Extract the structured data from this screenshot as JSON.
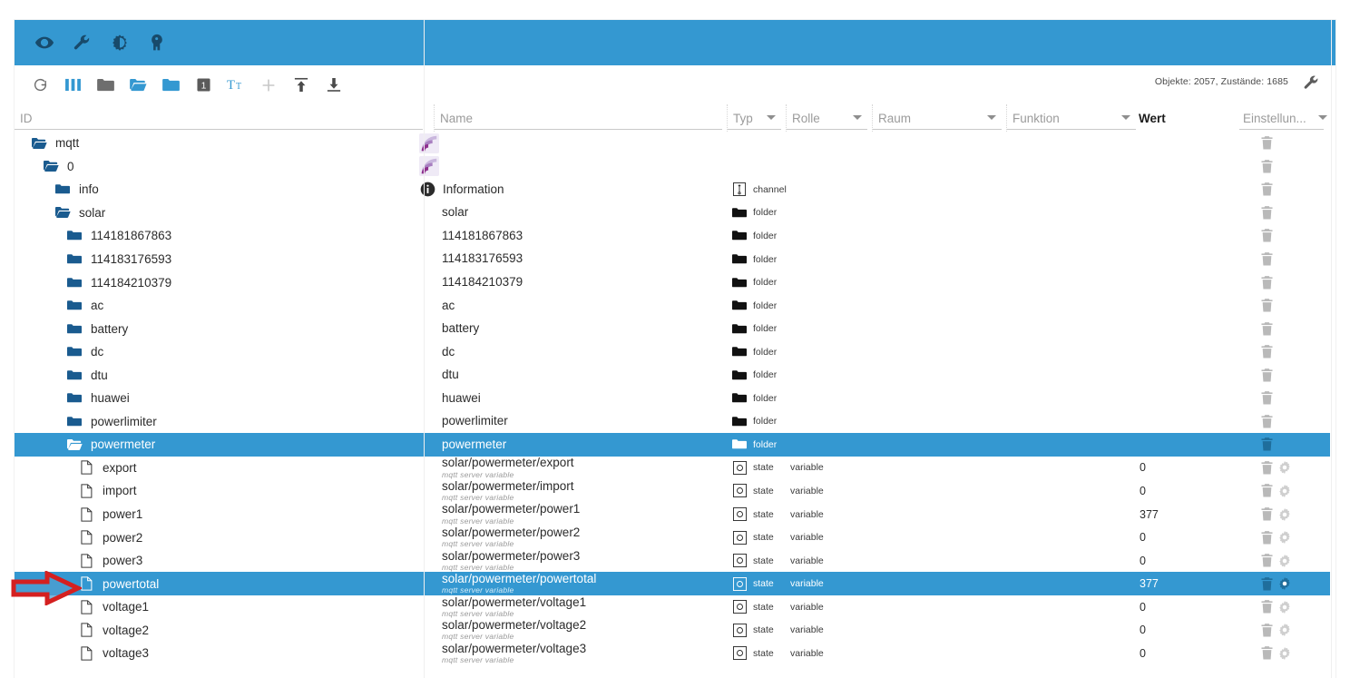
{
  "window": {
    "topbar_icons": [
      {
        "name": "eye-icon",
        "label": "eye"
      },
      {
        "name": "wrench-icon",
        "label": "wrench"
      },
      {
        "name": "contrast-icon",
        "label": "contrast"
      },
      {
        "name": "user-head-icon",
        "label": "user"
      }
    ]
  },
  "toolbar": {
    "icons": [
      {
        "name": "refresh-icon",
        "label": "Refresh"
      },
      {
        "name": "columns-icon",
        "label": "Columns"
      },
      {
        "name": "folder-closed-icon",
        "label": "Collapse all"
      },
      {
        "name": "folder-open-icon",
        "label": "Expand all"
      },
      {
        "name": "folder-filled-icon",
        "label": "Folders"
      },
      {
        "name": "depth-one-icon",
        "label": "1"
      },
      {
        "name": "text-size-icon",
        "label": "Tt"
      },
      {
        "name": "add-icon",
        "label": "Add"
      },
      {
        "name": "import-icon",
        "label": "Import"
      },
      {
        "name": "export-icon",
        "label": "Export"
      }
    ],
    "counts": "Objekte: 2057, Zustände: 1685",
    "settings_icon": "wrench-icon"
  },
  "columns": {
    "id": "ID",
    "name": "Name",
    "typ": "Typ",
    "rolle": "Rolle",
    "raum": "Raum",
    "funktion": "Funktion",
    "wert": "Wert",
    "einstellungen": "Einstellun..."
  },
  "rows": [
    {
      "id": "mqtt",
      "depth": 0,
      "icon": "folder-open-icon",
      "adapter_icon": "mqtt-adapter-icon",
      "name": "",
      "sub": "",
      "type": "",
      "role": "",
      "value": "",
      "actions": [
        "delete-icon"
      ],
      "selected": false
    },
    {
      "id": "0",
      "depth": 1,
      "icon": "folder-open-icon",
      "adapter_icon": "mqtt-adapter-icon",
      "name": "",
      "sub": "",
      "type": "",
      "role": "",
      "value": "",
      "actions": [
        "delete-icon"
      ],
      "selected": false
    },
    {
      "id": "info",
      "depth": 2,
      "icon": "folder-closed-icon",
      "adapter_icon": "",
      "name": "Information",
      "name_icon": "information-icon",
      "sub": "",
      "type": "channel",
      "type_icon": "channel-icon",
      "role": "",
      "value": "",
      "actions": [
        "delete-icon"
      ],
      "selected": false
    },
    {
      "id": "solar",
      "depth": 2,
      "icon": "folder-open-icon",
      "adapter_icon": "",
      "name": "solar",
      "sub": "",
      "type": "folder",
      "type_icon": "folder-icon",
      "role": "",
      "value": "",
      "actions": [
        "delete-icon"
      ],
      "selected": false
    },
    {
      "id": "114181867863",
      "depth": 3,
      "icon": "folder-closed-icon",
      "adapter_icon": "",
      "name": "114181867863",
      "sub": "",
      "type": "folder",
      "type_icon": "folder-icon",
      "role": "",
      "value": "",
      "actions": [
        "delete-icon"
      ],
      "selected": false
    },
    {
      "id": "114183176593",
      "depth": 3,
      "icon": "folder-closed-icon",
      "adapter_icon": "",
      "name": "114183176593",
      "sub": "",
      "type": "folder",
      "type_icon": "folder-icon",
      "role": "",
      "value": "",
      "actions": [
        "delete-icon"
      ],
      "selected": false
    },
    {
      "id": "114184210379",
      "depth": 3,
      "icon": "folder-closed-icon",
      "adapter_icon": "",
      "name": "114184210379",
      "sub": "",
      "type": "folder",
      "type_icon": "folder-icon",
      "role": "",
      "value": "",
      "actions": [
        "delete-icon"
      ],
      "selected": false
    },
    {
      "id": "ac",
      "depth": 3,
      "icon": "folder-closed-icon",
      "adapter_icon": "",
      "name": "ac",
      "sub": "",
      "type": "folder",
      "type_icon": "folder-icon",
      "role": "",
      "value": "",
      "actions": [
        "delete-icon"
      ],
      "selected": false
    },
    {
      "id": "battery",
      "depth": 3,
      "icon": "folder-closed-icon",
      "adapter_icon": "",
      "name": "battery",
      "sub": "",
      "type": "folder",
      "type_icon": "folder-icon",
      "role": "",
      "value": "",
      "actions": [
        "delete-icon"
      ],
      "selected": false
    },
    {
      "id": "dc",
      "depth": 3,
      "icon": "folder-closed-icon",
      "adapter_icon": "",
      "name": "dc",
      "sub": "",
      "type": "folder",
      "type_icon": "folder-icon",
      "role": "",
      "value": "",
      "actions": [
        "delete-icon"
      ],
      "selected": false
    },
    {
      "id": "dtu",
      "depth": 3,
      "icon": "folder-closed-icon",
      "adapter_icon": "",
      "name": "dtu",
      "sub": "",
      "type": "folder",
      "type_icon": "folder-icon",
      "role": "",
      "value": "",
      "actions": [
        "delete-icon"
      ],
      "selected": false
    },
    {
      "id": "huawei",
      "depth": 3,
      "icon": "folder-closed-icon",
      "adapter_icon": "",
      "name": "huawei",
      "sub": "",
      "type": "folder",
      "type_icon": "folder-icon",
      "role": "",
      "value": "",
      "actions": [
        "delete-icon"
      ],
      "selected": false
    },
    {
      "id": "powerlimiter",
      "depth": 3,
      "icon": "folder-closed-icon",
      "adapter_icon": "",
      "name": "powerlimiter",
      "sub": "",
      "type": "folder",
      "type_icon": "folder-icon",
      "role": "",
      "value": "",
      "actions": [
        "delete-icon"
      ],
      "selected": false
    },
    {
      "id": "powermeter",
      "depth": 3,
      "icon": "folder-open-icon",
      "adapter_icon": "",
      "name": "powermeter",
      "sub": "",
      "type": "folder",
      "type_icon": "folder-icon",
      "role": "",
      "value": "",
      "actions": [
        "delete-icon"
      ],
      "selected": true
    },
    {
      "id": "export",
      "depth": 4,
      "icon": "state-file-icon",
      "adapter_icon": "",
      "name": "solar/powermeter/export",
      "sub": "mqtt server variable",
      "type": "state",
      "type_icon": "state-icon",
      "role": "variable",
      "value": "0",
      "actions": [
        "delete-icon",
        "settings-icon"
      ],
      "selected": false
    },
    {
      "id": "import",
      "depth": 4,
      "icon": "state-file-icon",
      "adapter_icon": "",
      "name": "solar/powermeter/import",
      "sub": "mqtt server variable",
      "type": "state",
      "type_icon": "state-icon",
      "role": "variable",
      "value": "0",
      "actions": [
        "delete-icon",
        "settings-icon"
      ],
      "selected": false
    },
    {
      "id": "power1",
      "depth": 4,
      "icon": "state-file-icon",
      "adapter_icon": "",
      "name": "solar/powermeter/power1",
      "sub": "mqtt server variable",
      "type": "state",
      "type_icon": "state-icon",
      "role": "variable",
      "value": "377",
      "actions": [
        "delete-icon",
        "settings-icon"
      ],
      "selected": false
    },
    {
      "id": "power2",
      "depth": 4,
      "icon": "state-file-icon",
      "adapter_icon": "",
      "name": "solar/powermeter/power2",
      "sub": "mqtt server variable",
      "type": "state",
      "type_icon": "state-icon",
      "role": "variable",
      "value": "0",
      "actions": [
        "delete-icon",
        "settings-icon"
      ],
      "selected": false
    },
    {
      "id": "power3",
      "depth": 4,
      "icon": "state-file-icon",
      "adapter_icon": "",
      "name": "solar/powermeter/power3",
      "sub": "mqtt server variable",
      "type": "state",
      "type_icon": "state-icon",
      "role": "variable",
      "value": "0",
      "actions": [
        "delete-icon",
        "settings-icon"
      ],
      "selected": false
    },
    {
      "id": "powertotal",
      "depth": 4,
      "icon": "state-file-icon",
      "adapter_icon": "",
      "name": "solar/powermeter/powertotal",
      "sub": "mqtt server variable",
      "type": "state",
      "type_icon": "state-icon",
      "role": "variable",
      "value": "377",
      "actions": [
        "delete-icon",
        "settings-icon"
      ],
      "selected": true
    },
    {
      "id": "voltage1",
      "depth": 4,
      "icon": "state-file-icon",
      "adapter_icon": "",
      "name": "solar/powermeter/voltage1",
      "sub": "mqtt server variable",
      "type": "state",
      "type_icon": "state-icon",
      "role": "variable",
      "value": "0",
      "actions": [
        "delete-icon",
        "settings-icon"
      ],
      "selected": false
    },
    {
      "id": "voltage2",
      "depth": 4,
      "icon": "state-file-icon",
      "adapter_icon": "",
      "name": "solar/powermeter/voltage2",
      "sub": "mqtt server variable",
      "type": "state",
      "type_icon": "state-icon",
      "role": "variable",
      "value": "0",
      "actions": [
        "delete-icon",
        "settings-icon"
      ],
      "selected": false
    },
    {
      "id": "voltage3",
      "depth": 4,
      "icon": "state-file-icon",
      "adapter_icon": "",
      "name": "solar/powermeter/voltage3",
      "sub": "mqtt server variable",
      "type": "state",
      "type_icon": "state-icon",
      "role": "variable",
      "value": "0",
      "actions": [
        "delete-icon",
        "settings-icon"
      ],
      "selected": false
    }
  ],
  "annotation": {
    "arrow": "red-right-arrow",
    "points_at": "powertotal"
  },
  "colors": {
    "accent": "#3498d1",
    "topbar_icon": "#184a6b",
    "folder_blue": "#1a5b8f",
    "annotation_red": "#d42020"
  }
}
